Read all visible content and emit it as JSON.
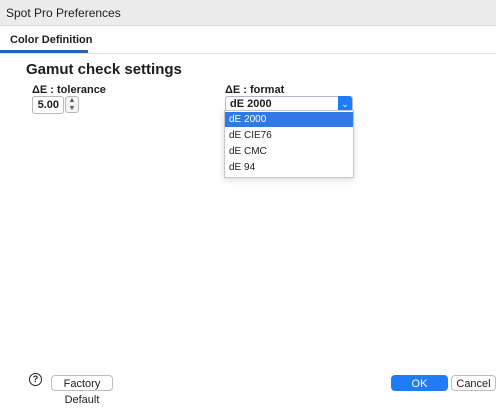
{
  "window": {
    "title": "Spot Pro Preferences"
  },
  "tabs": [
    {
      "label": "Color Definition"
    }
  ],
  "section": {
    "title": "Gamut check settings"
  },
  "tolerance": {
    "label": "ΔE : tolerance",
    "value": "5.00"
  },
  "format": {
    "label": "ΔE : format",
    "selected": "dE 2000",
    "options": [
      "dE 2000",
      "dE CIE76",
      "dE CMC",
      "dE 94"
    ]
  },
  "footer": {
    "help": "?",
    "factory_default": "Factory Default",
    "ok": "OK",
    "cancel": "Cancel"
  },
  "colors": {
    "accent": "#1f7cf6",
    "tab_underline": "#2a5fb6",
    "selected_option": "#2f7ae5"
  }
}
